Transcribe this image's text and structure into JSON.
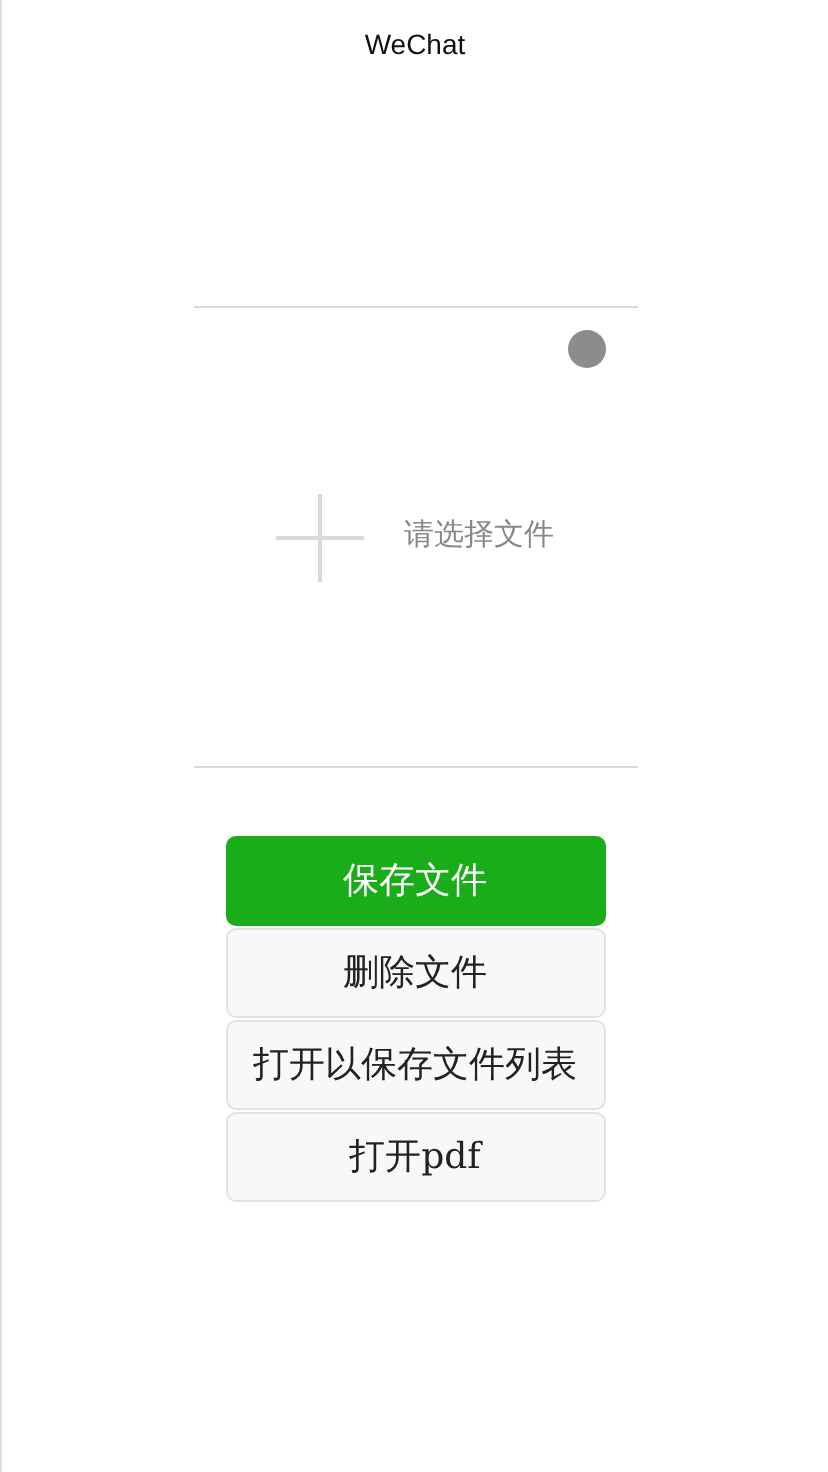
{
  "nav_bar": {
    "title": "WeChat"
  },
  "upload_area": {
    "prompt": "请选择文件"
  },
  "buttons": [
    {
      "label": "保存文件",
      "kind": "primary"
    },
    {
      "label": "删除文件",
      "kind": "default"
    },
    {
      "label": "打开以保存文件列表",
      "kind": "default"
    },
    {
      "label": "打开pdf",
      "kind": "default"
    }
  ]
}
